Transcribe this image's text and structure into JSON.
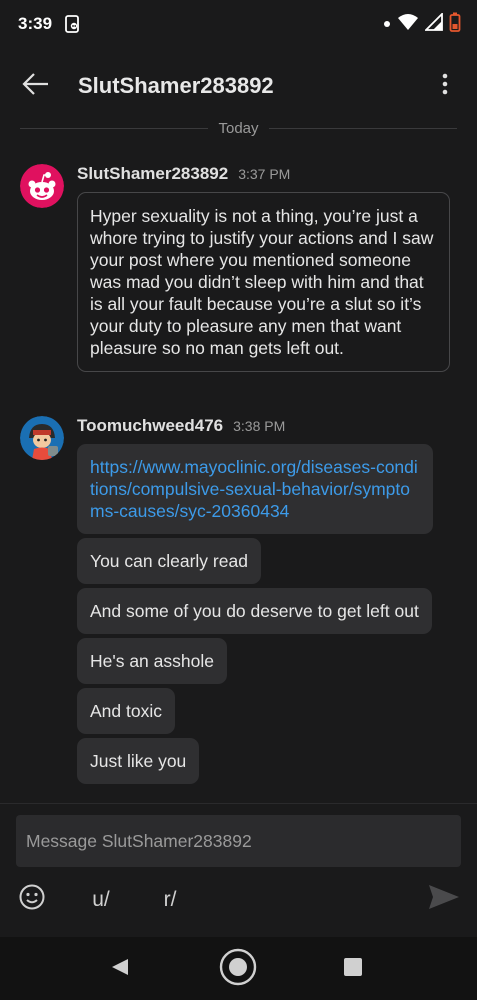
{
  "status_bar": {
    "time": "3:39"
  },
  "header": {
    "title": "SlutShamer283892"
  },
  "date_divider": "Today",
  "messages": [
    {
      "sender": "SlutShamer283892",
      "time": "3:37 PM",
      "bubbles": [
        "Hyper sexuality is not a thing, you’re just a whore trying to justify your actions and I saw your post where you mentioned someone was mad you didn’t sleep with him and that is all your fault because you’re a slut so it’s your duty to pleasure any men that want pleasure so no man gets left out."
      ]
    },
    {
      "sender": "Toomuchweed476",
      "time": "3:38 PM",
      "link": "https://www.mayoclinic.org/diseases-conditions/compulsive-sexual-behavior/symptoms-causes/syc-20360434",
      "bubbles": [
        "You can clearly read",
        "And some of you do deserve to get left out",
        "He's an asshole",
        "And toxic",
        "Just like you"
      ]
    }
  ],
  "composer": {
    "placeholder": "Message SlutShamer283892",
    "user_button": "u/",
    "subreddit_button": "r/"
  },
  "icons": {
    "back": "arrow-left-icon",
    "more": "more-vertical-icon",
    "emoji": "emoji-icon",
    "send": "send-icon",
    "nav_back": "triangle-back-icon",
    "nav_home": "home-circle-icon",
    "nav_recents": "square-recents-icon"
  },
  "colors": {
    "background": "#1a1a1b",
    "bubble": "#2f2f31",
    "link": "#3d9be9",
    "avatar_1": "#e0115f",
    "avatar_2": "#1a6fb3"
  }
}
